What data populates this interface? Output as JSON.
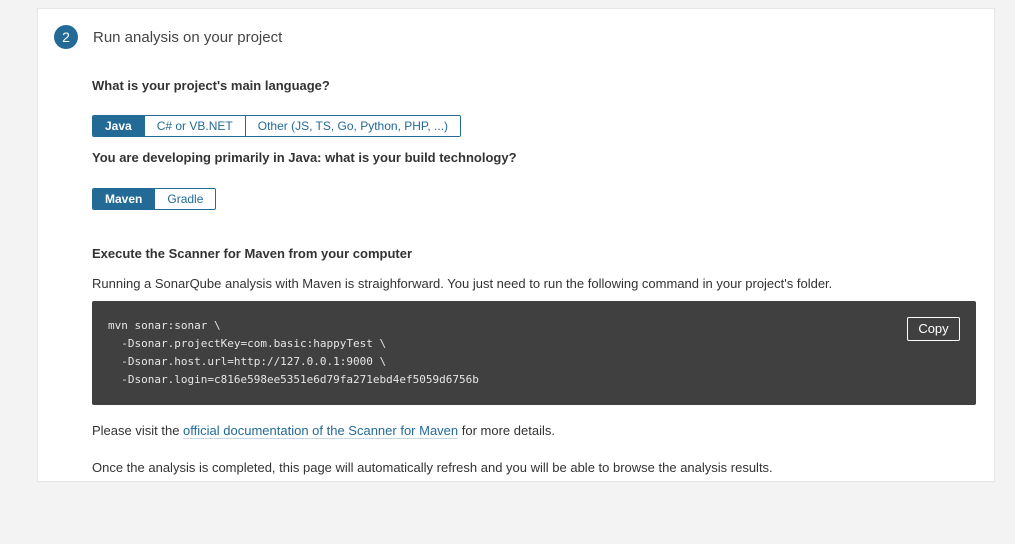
{
  "step": {
    "number": "2",
    "title": "Run analysis on your project"
  },
  "language": {
    "question": "What is your project's main language?",
    "options": [
      {
        "label": "Java",
        "selected": true
      },
      {
        "label": "C# or VB.NET",
        "selected": false
      },
      {
        "label": "Other (JS, TS, Go, Python, PHP, ...)",
        "selected": false
      }
    ]
  },
  "build": {
    "question": "You are developing primarily in Java: what is your build technology?",
    "options": [
      {
        "label": "Maven",
        "selected": true
      },
      {
        "label": "Gradle",
        "selected": false
      }
    ]
  },
  "execute": {
    "title": "Execute the Scanner for Maven from your computer",
    "intro": "Running a SonarQube analysis with Maven is straighforward. You just need to run the following command in your project's folder.",
    "code_lines": [
      "mvn sonar:sonar \\",
      "  -Dsonar.projectKey=com.basic:happyTest \\",
      "  -Dsonar.host.url=http://127.0.0.1:9000 \\",
      "  -Dsonar.login=c816e598ee5351e6d79fa271ebd4ef5059d6756b"
    ],
    "copy_label": "Copy"
  },
  "visit": {
    "prefix": "Please visit the ",
    "link": "official documentation of the Scanner for Maven",
    "suffix": " for more details."
  },
  "outro": "Once the analysis is completed, this page will automatically refresh and you will be able to browse the analysis results.",
  "colors": {
    "accent": "#236a97",
    "code_background": "#404040",
    "page_background": "#f3f3f3"
  }
}
